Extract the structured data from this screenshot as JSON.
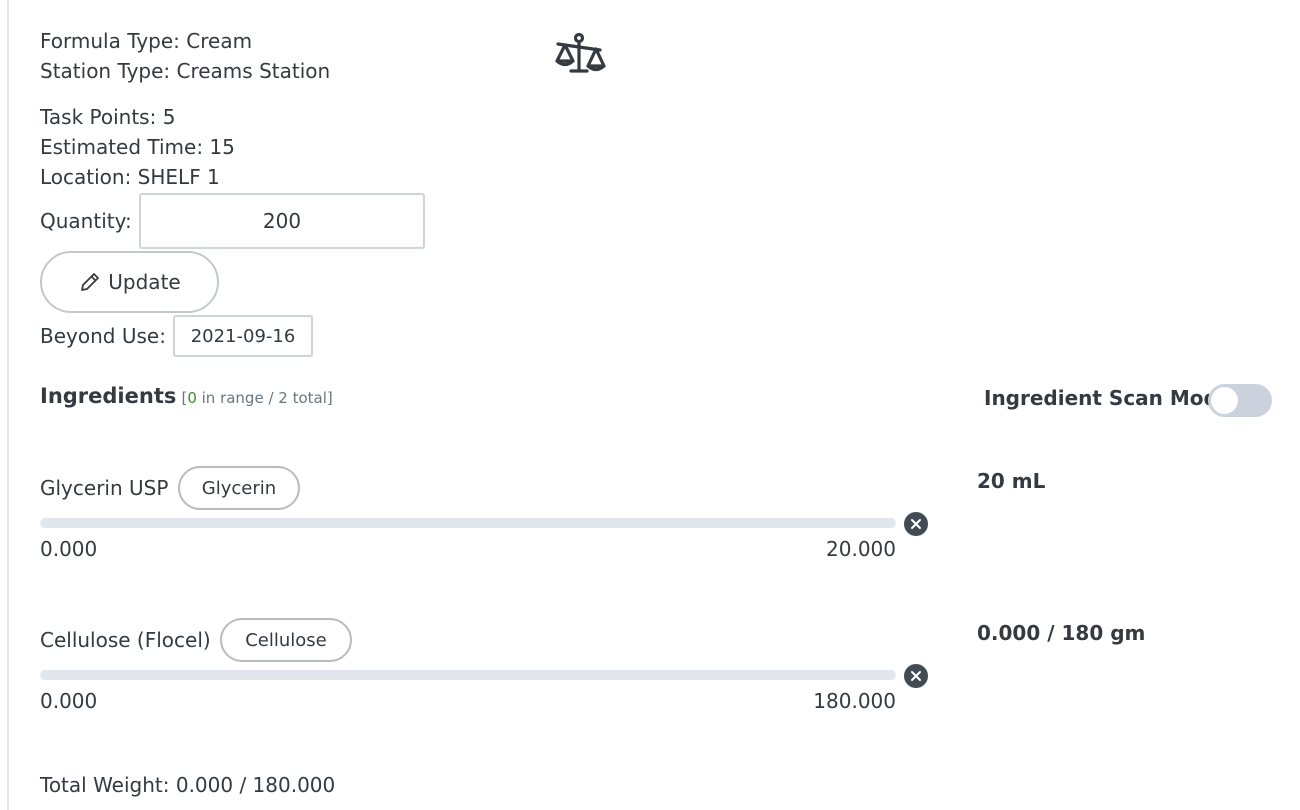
{
  "details": {
    "formula_type": "Formula Type: Cream",
    "station_type": "Station Type: Creams Station",
    "task_points": "Task Points: 5",
    "estimated_time": "Estimated Time: 15",
    "location": "Location: SHELF 1",
    "quantity_label": "Quantity:",
    "quantity_value": "200",
    "update_label": "Update",
    "beyond_use_label": "Beyond Use:",
    "beyond_use_date": "2021-09-16"
  },
  "icons": {
    "scale": "balance-scale-icon",
    "update": "pencil-icon",
    "remove": "close-circle-icon"
  },
  "ingredients": {
    "title": "Ingredients",
    "bracket_open": "[",
    "in_range_count": "0",
    "in_range_text": " in range / 2 total",
    "bracket_close": "]",
    "scan_mode_label": "Ingredient Scan Mode",
    "scan_mode_on": false,
    "items": [
      {
        "name": "Glycerin USP",
        "tag": "Glycerin",
        "min": "0.000",
        "max": "20.000",
        "amount": "20 mL"
      },
      {
        "name": "Cellulose (Flocel)",
        "tag": "Cellulose",
        "min": "0.000",
        "max": "180.000",
        "amount": "0.000 / 180 gm"
      }
    ]
  },
  "total_weight": "Total Weight: 0.000 / 180.000",
  "colors": {
    "text": "#343a40",
    "in_range_green": "#3c8a2e",
    "track": "#e2e6ee",
    "toggle_off": "#cbd2de"
  }
}
